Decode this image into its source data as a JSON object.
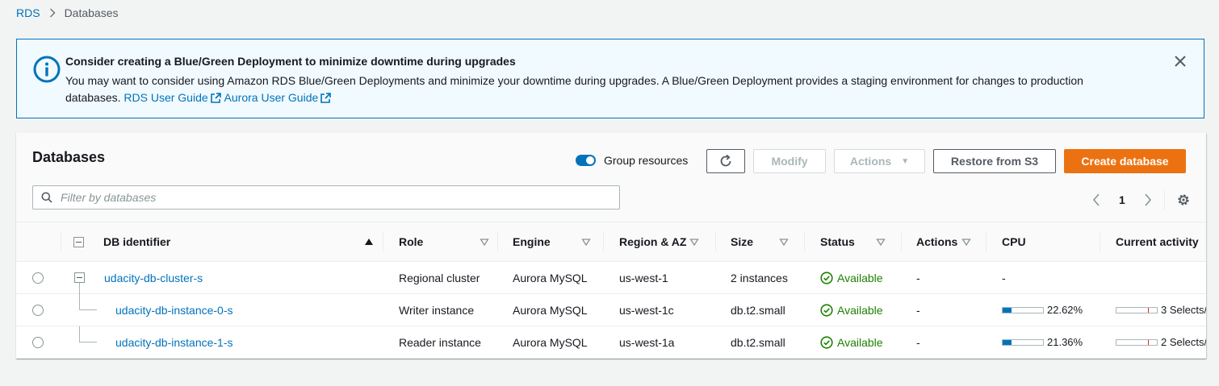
{
  "breadcrumb": {
    "root": "RDS",
    "current": "Databases"
  },
  "banner": {
    "title": "Consider creating a Blue/Green Deployment to minimize downtime during upgrades",
    "body": "You may want to consider using Amazon RDS Blue/Green Deployments and minimize your downtime during upgrades. A Blue/Green Deployment provides a staging environment for changes to production databases.",
    "link_rds": "RDS User Guide",
    "link_aurora": "Aurora User Guide"
  },
  "panel": {
    "title": "Databases",
    "group_resources_label": "Group resources",
    "modify_label": "Modify",
    "actions_label": "Actions",
    "restore_label": "Restore from S3",
    "create_label": "Create database",
    "filter_placeholder": "Filter by databases",
    "page_number": "1"
  },
  "table": {
    "columns": [
      "DB identifier",
      "Role",
      "Engine",
      "Region & AZ",
      "Size",
      "Status",
      "Actions",
      "CPU",
      "Current activity"
    ],
    "rows": [
      {
        "id": "udacity-db-cluster-s",
        "role": "Regional cluster",
        "engine": "Aurora MySQL",
        "region": "us-west-1",
        "size": "2 instances",
        "status": "Available",
        "actions": "-",
        "cpu": "-",
        "cpu_pct": null,
        "activity": ""
      },
      {
        "id": "udacity-db-instance-0-s",
        "role": "Writer instance",
        "engine": "Aurora MySQL",
        "region": "us-west-1c",
        "size": "db.t2.small",
        "status": "Available",
        "actions": "-",
        "cpu": "22.62%",
        "cpu_pct": 22.62,
        "activity": "3 Selects/"
      },
      {
        "id": "udacity-db-instance-1-s",
        "role": "Reader instance",
        "engine": "Aurora MySQL",
        "region": "us-west-1a",
        "size": "db.t2.small",
        "status": "Available",
        "actions": "-",
        "cpu": "21.36%",
        "cpu_pct": 21.36,
        "activity": "2 Selects/"
      }
    ]
  },
  "colors": {
    "link": "#0073bb",
    "primary_button": "#ec7211",
    "status_available": "#1d8102"
  },
  "icons": [
    "info-icon",
    "close-icon",
    "external-link-icon",
    "refresh-icon",
    "search-icon",
    "chevron-left-icon",
    "chevron-right-icon",
    "gear-icon",
    "check-circle-icon",
    "sort-icon"
  ]
}
